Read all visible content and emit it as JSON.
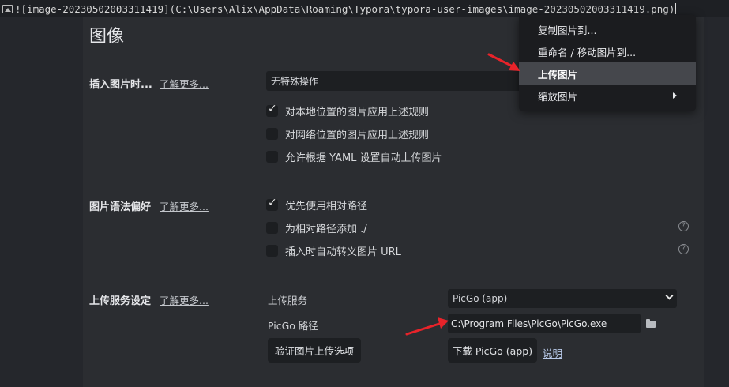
{
  "editor": {
    "markdown_source": "![image-20230502003311419](C:\\Users\\Alix\\AppData\\Roaming\\Typora\\typora-user-images\\image-20230502003311419.png)"
  },
  "page": {
    "title": "图像"
  },
  "insert_section": {
    "label": "插入图片时...",
    "learn_more": "了解更多...",
    "action_value": "无特殊操作",
    "options": [
      {
        "label": "对本地位置的图片应用上述规则",
        "checked": true
      },
      {
        "label": "对网络位置的图片应用上述规则",
        "checked": false
      },
      {
        "label": "允许根据 YAML 设置自动上传图片",
        "checked": false
      }
    ]
  },
  "syntax_section": {
    "label": "图片语法偏好",
    "learn_more": "了解更多...",
    "options": [
      {
        "label": "优先使用相对路径",
        "checked": true
      },
      {
        "label": "为相对路径添加 ./",
        "checked": false,
        "help": "?"
      },
      {
        "label": "插入时自动转义图片 URL",
        "checked": false,
        "help": "?"
      }
    ]
  },
  "upload_section": {
    "label": "上传服务设定",
    "learn_more": "了解更多...",
    "service_label": "上传服务",
    "service_value": "PicGo (app)",
    "path_label": "PicGo 路径",
    "path_value": "C:\\Program Files\\PicGo\\PicGo.exe",
    "verify_button": "验证图片上传选项",
    "download_button": "下载 PicGo (app)",
    "help_link": "说明"
  },
  "context_menu": {
    "items": [
      {
        "label": "复制图片到..."
      },
      {
        "label": "重命名 / 移动图片到..."
      },
      {
        "label": "上传图片",
        "active": true
      },
      {
        "label": "缩放图片",
        "has_submenu": true
      }
    ]
  },
  "colors": {
    "annotation_arrow": "#e8232a",
    "panel_bg": "#2b2d31",
    "menu_active_bg": "#45474c"
  }
}
